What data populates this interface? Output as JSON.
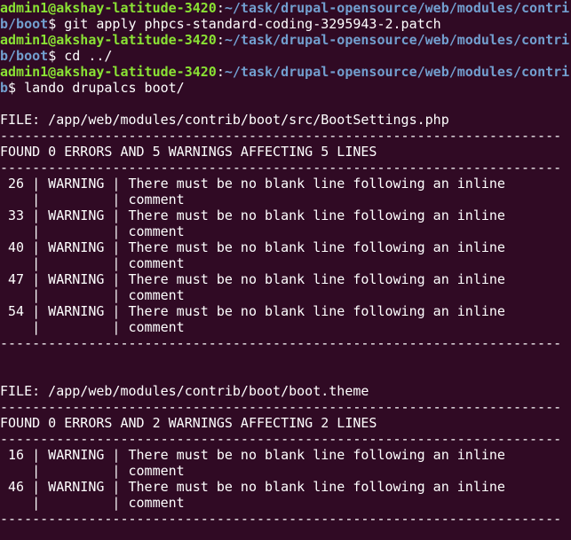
{
  "colors": {
    "background": "#300a24",
    "prompt_user": "#8ae234",
    "prompt_path": "#729fcf",
    "text": "#ffffff"
  },
  "lines": [
    {
      "type": "prompt-cont",
      "user": "admin1@akshay-latitude-3420",
      "sep": ":",
      "path": "~/task/drupal-opensource/web/modules/contri"
    },
    {
      "type": "path-cmd",
      "path": "b/boot",
      "text": "$ git apply phpcs-standard-coding-3295943-2.patch"
    },
    {
      "type": "prompt-cont",
      "user": "admin1@akshay-latitude-3420",
      "sep": ":",
      "path": "~/task/drupal-opensource/web/modules/contri"
    },
    {
      "type": "path-cmd",
      "path": "b/boot",
      "text": "$ cd ../"
    },
    {
      "type": "prompt-cont",
      "user": "admin1@akshay-latitude-3420",
      "sep": ":",
      "path": "~/task/drupal-opensource/web/modules/contri"
    },
    {
      "type": "path-cmd",
      "path": "b",
      "text": "$ lando drupalcs boot/"
    },
    {
      "type": "text",
      "text": ""
    },
    {
      "type": "text",
      "text": "FILE: /app/web/modules/contrib/boot/src/BootSettings.php"
    },
    {
      "type": "text",
      "text": "----------------------------------------------------------------------"
    },
    {
      "type": "text",
      "text": "FOUND 0 ERRORS AND 5 WARNINGS AFFECTING 5 LINES"
    },
    {
      "type": "text",
      "text": "----------------------------------------------------------------------"
    },
    {
      "type": "text",
      "text": " 26 | WARNING | There must be no blank line following an inline"
    },
    {
      "type": "text",
      "text": "    |         | comment"
    },
    {
      "type": "text",
      "text": " 33 | WARNING | There must be no blank line following an inline"
    },
    {
      "type": "text",
      "text": "    |         | comment"
    },
    {
      "type": "text",
      "text": " 40 | WARNING | There must be no blank line following an inline"
    },
    {
      "type": "text",
      "text": "    |         | comment"
    },
    {
      "type": "text",
      "text": " 47 | WARNING | There must be no blank line following an inline"
    },
    {
      "type": "text",
      "text": "    |         | comment"
    },
    {
      "type": "text",
      "text": " 54 | WARNING | There must be no blank line following an inline"
    },
    {
      "type": "text",
      "text": "    |         | comment"
    },
    {
      "type": "text",
      "text": "----------------------------------------------------------------------"
    },
    {
      "type": "text",
      "text": ""
    },
    {
      "type": "text",
      "text": ""
    },
    {
      "type": "text",
      "text": "FILE: /app/web/modules/contrib/boot/boot.theme"
    },
    {
      "type": "text",
      "text": "----------------------------------------------------------------------"
    },
    {
      "type": "text",
      "text": "FOUND 0 ERRORS AND 2 WARNINGS AFFECTING 2 LINES"
    },
    {
      "type": "text",
      "text": "----------------------------------------------------------------------"
    },
    {
      "type": "text",
      "text": " 16 | WARNING | There must be no blank line following an inline"
    },
    {
      "type": "text",
      "text": "    |         | comment"
    },
    {
      "type": "text",
      "text": " 46 | WARNING | There must be no blank line following an inline"
    },
    {
      "type": "text",
      "text": "    |         | comment"
    },
    {
      "type": "text",
      "text": "----------------------------------------------------------------------"
    }
  ]
}
